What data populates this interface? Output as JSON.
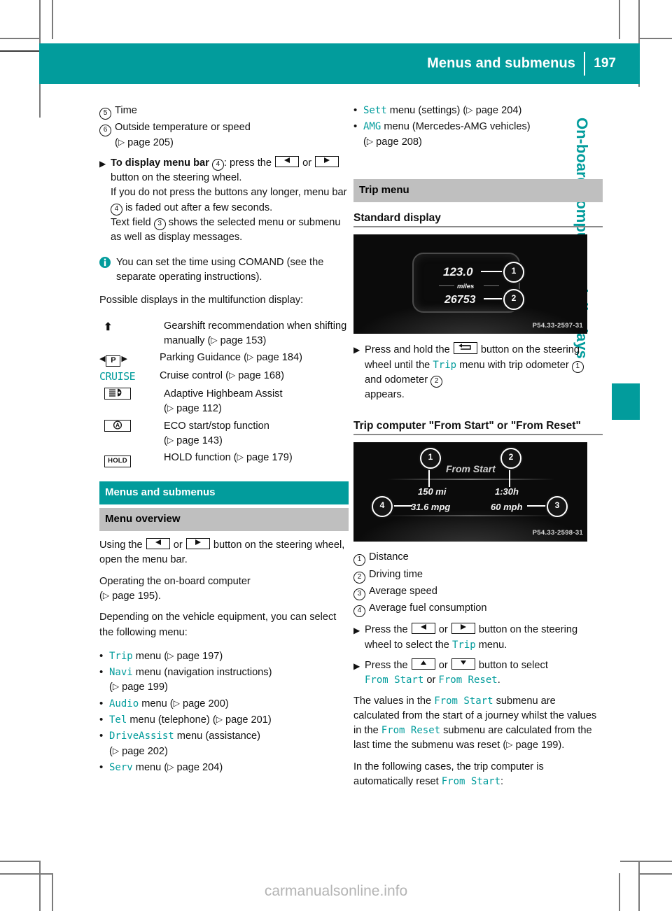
{
  "header": {
    "title": "Menus and submenus",
    "page_number": "197"
  },
  "side_tab": {
    "label": "On-board computer and displays",
    "accent_color": "#029C9C"
  },
  "watermark": "carmanualsonline.info",
  "left_column": {
    "legend_items": [
      {
        "num": "5",
        "text": "Time"
      },
      {
        "num": "6",
        "text": "Outside temperature or speed"
      }
    ],
    "legend_6_pageref": "page 205",
    "step_menu_bar": {
      "bold_lead": "To display menu bar",
      "num": "4",
      "after_num": ": press the",
      "or_word": "or",
      "after_keys": "button on the steering wheel.",
      "line2": "If you do not press the buttons any longer, menu bar",
      "line2_num": "4",
      "line2_end": "is faded out after a few seconds.",
      "line3_pre": "Text field",
      "line3_num": "3",
      "line3_post": "shows the selected menu or submenu as well as display messages."
    },
    "note": "You can set the time using COMAND (see the separate operating instructions).",
    "possible_displays_intro": "Possible displays in the multifunction display:",
    "symbols": [
      {
        "icon": "gearshift-arrow-icon",
        "glyph": "↑",
        "desc": "Gearshift recommendation when shifting manually",
        "pageref": "page 153"
      },
      {
        "icon": "parking-guidance-icon",
        "glyph": "P",
        "desc": "Parking Guidance",
        "pageref": "page 184"
      },
      {
        "icon": "cruise-text-icon",
        "glyph": "CRUISE",
        "desc": "Cruise control",
        "pageref": "page 168"
      },
      {
        "icon": "adaptive-highbeam-icon",
        "glyph": "",
        "desc": "Adaptive Highbeam Assist",
        "pageref": "page 112"
      },
      {
        "icon": "eco-start-stop-icon",
        "glyph": "A",
        "desc": "ECO start/stop function",
        "pageref": "page 143"
      },
      {
        "icon": "hold-function-icon",
        "glyph": "HOLD",
        "desc": "HOLD function",
        "pageref": "page 179"
      }
    ],
    "section_heading": "Menus and submenus",
    "subsection_heading": "Menu overview",
    "para_using": {
      "pre": "Using the",
      "or_word": "or",
      "post": "button on the steering wheel, open the menu bar."
    },
    "para_operating": "Operating the on-board computer",
    "para_operating_pageref": "page 195",
    "para_depending": "Depending on the vehicle equipment, you can select the following menu:",
    "menu_bullets": [
      {
        "name": "Trip",
        "desc": "menu",
        "pageref": "page 197"
      },
      {
        "name": "Navi",
        "desc": "menu (navigation instructions)",
        "pageref": "page 199"
      },
      {
        "name": "Audio",
        "desc": "menu",
        "pageref": "page 200"
      },
      {
        "name": "Tel",
        "desc": "menu (telephone)",
        "pageref": "page 201"
      },
      {
        "name": "DriveAssist",
        "desc": "menu (assistance)",
        "pageref": "page 202"
      },
      {
        "name": "Serv",
        "desc": "menu",
        "pageref": "page 204"
      }
    ]
  },
  "right_column": {
    "menu_bullets": [
      {
        "name": "Sett",
        "desc": "menu (settings)",
        "pageref": "page 204"
      },
      {
        "name": "AMG",
        "desc": "menu (Mercedes-AMG vehicles)",
        "pageref": "page 208"
      }
    ],
    "trip_menu_heading": "Trip menu",
    "standard_display_heading": "Standard display",
    "figure1": {
      "caption": "P54.33-2597-31",
      "trip_odometer": "123.0",
      "unit": "miles",
      "odometer": "26753",
      "callouts": [
        "1",
        "2"
      ]
    },
    "step_press_hold": {
      "pre": "Press and hold the",
      "mid": "button on the steering wheel until the",
      "menu_name": "Trip",
      "post1": "menu with trip odometer",
      "num1": "1",
      "post2": "and odometer",
      "num2": "2",
      "post3": "appears."
    },
    "trip_computer_heading": "Trip computer \"From Start\" or \"From Reset\"",
    "figure2": {
      "caption": "P54.33-2598-31",
      "title": "From Start",
      "distance": "150 mi",
      "driving_time": "1:30h",
      "consumption": "31.6 mpg",
      "avg_speed": "60 mph",
      "callouts": [
        "1",
        "2",
        "3",
        "4"
      ]
    },
    "legend_items": [
      {
        "num": "1",
        "text": "Distance"
      },
      {
        "num": "2",
        "text": "Driving time"
      },
      {
        "num": "3",
        "text": "Average speed"
      },
      {
        "num": "4",
        "text": "Average fuel consumption"
      }
    ],
    "step_select_trip": {
      "pre": "Press the",
      "or_word": "or",
      "mid": "button on the steering wheel to select the",
      "menu_name": "Trip",
      "post": "menu."
    },
    "step_select_submenu": {
      "pre": "Press the",
      "or_word": "or",
      "mid": "button to select",
      "opt1": "From Start",
      "or2": "or",
      "opt2": "From Reset",
      "post": "."
    },
    "para_values": {
      "p1": "The values in the",
      "opt1": "From Start",
      "p2": "submenu are calculated from the start of a journey whilst the values in the",
      "opt2": "From Reset",
      "p3": "submenu are calculated from the last time the submenu was reset",
      "pageref": "page 199",
      "p4": "."
    },
    "para_following": {
      "pre": "In the following cases, the trip computer is automatically reset",
      "opt": "From Start",
      "post": ":"
    }
  }
}
